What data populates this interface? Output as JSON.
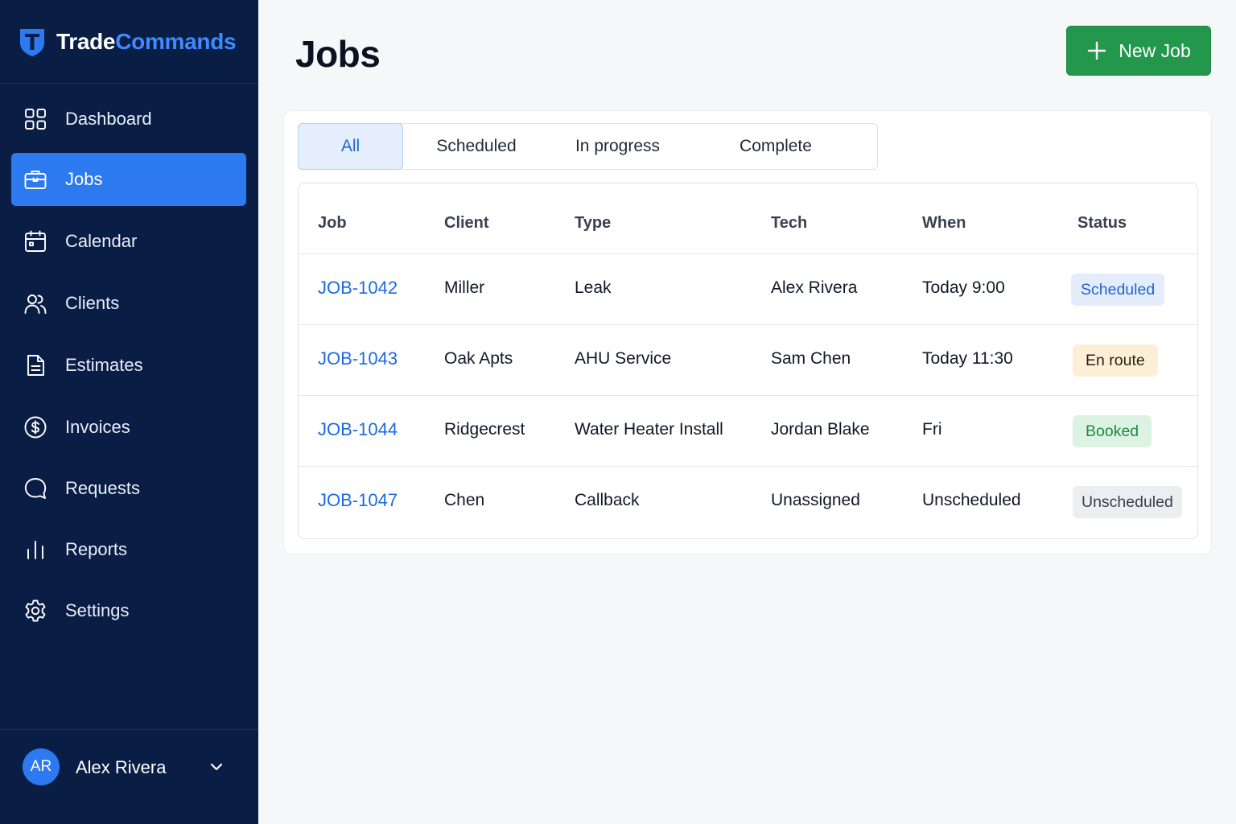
{
  "brand": {
    "part1": "Trade",
    "part2": "Commands"
  },
  "nav": {
    "items": [
      {
        "label": "Dashboard",
        "icon": "dashboard-icon",
        "active": false
      },
      {
        "label": "Jobs",
        "icon": "briefcase-icon",
        "active": true
      },
      {
        "label": "Calendar",
        "icon": "calendar-icon",
        "active": false
      },
      {
        "label": "Clients",
        "icon": "users-icon",
        "active": false
      },
      {
        "label": "Estimates",
        "icon": "document-icon",
        "active": false
      },
      {
        "label": "Invoices",
        "icon": "dollar-icon",
        "active": false
      },
      {
        "label": "Requests",
        "icon": "chat-icon",
        "active": false
      },
      {
        "label": "Reports",
        "icon": "bar-chart-icon",
        "active": false
      },
      {
        "label": "Settings",
        "icon": "gear-icon",
        "active": false
      }
    ]
  },
  "user": {
    "initials": "AR",
    "name": "Alex Rivera"
  },
  "header": {
    "title": "Jobs",
    "new_job_label": "New Job"
  },
  "tabs": [
    {
      "label": "All",
      "active": true
    },
    {
      "label": "Scheduled",
      "active": false
    },
    {
      "label": "In progress",
      "active": false
    },
    {
      "label": "Complete",
      "active": false
    }
  ],
  "table": {
    "columns": [
      "Job",
      "Client",
      "Type",
      "Tech",
      "When",
      "Status"
    ],
    "rows": [
      {
        "job": "JOB-1042",
        "client": "Miller",
        "type": "Leak",
        "tech": "Alex Rivera",
        "when": "Today 9:00",
        "status": "Scheduled"
      },
      {
        "job": "JOB-1043",
        "client": "Oak Apts",
        "type": "AHU Service",
        "tech": "Sam Chen",
        "when": "Today 11:30",
        "status": "En route"
      },
      {
        "job": "JOB-1044",
        "client": "Ridgecrest",
        "type": "Water Heater Install",
        "tech": "Jordan Blake",
        "when": "Fri",
        "status": "Booked"
      },
      {
        "job": "JOB-1047",
        "client": "Chen",
        "type": "Callback",
        "tech": "Unassigned",
        "when": "Unscheduled",
        "status": "Unscheduled"
      }
    ]
  },
  "colors": {
    "sidebar_bg": "#0a1e45",
    "accent_blue": "#2c79f0",
    "primary_green": "#23984d",
    "link_blue": "#1d6ae0",
    "status_scheduled": {
      "bg": "#e3edfb",
      "fg": "#2064d4"
    },
    "status_en_route": {
      "bg": "#fcefd6",
      "fg": "#2a2113"
    },
    "status_booked": {
      "bg": "#dcf2e2",
      "fg": "#1f8a45"
    },
    "status_unscheduled": {
      "bg": "#eceef2",
      "fg": "#374151"
    }
  }
}
